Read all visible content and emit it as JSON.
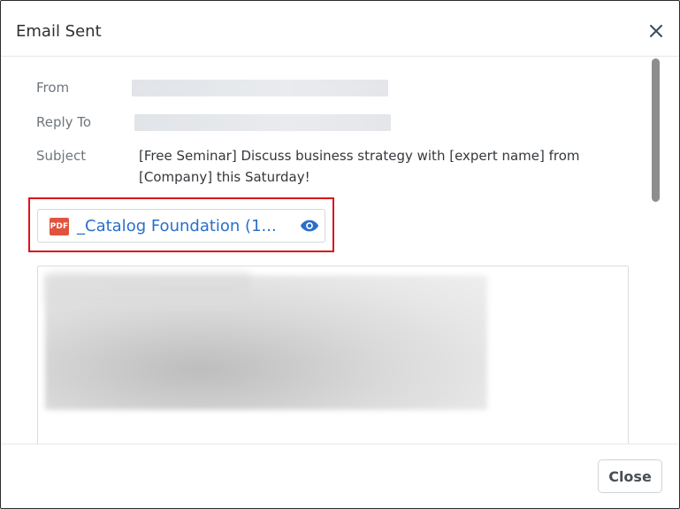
{
  "dialog": {
    "title": "Email Sent",
    "close_icon": "close-icon"
  },
  "fields": {
    "from_label": "From",
    "reply_to_label": "Reply To",
    "subject_label": "Subject",
    "subject_value": "[Free Seminar] Discuss business strategy with [expert name] from [Company] this Saturday!"
  },
  "attachment": {
    "icon": "pdf-icon",
    "icon_text": "PDF",
    "name": "_Catalog Foundation (1...",
    "preview_icon": "eye-icon",
    "highlight_color": "#d9141b"
  },
  "footer": {
    "close_label": "Close"
  },
  "colors": {
    "link": "#2a6fcb",
    "label": "#6f757b",
    "pdf": "#e0533e"
  }
}
